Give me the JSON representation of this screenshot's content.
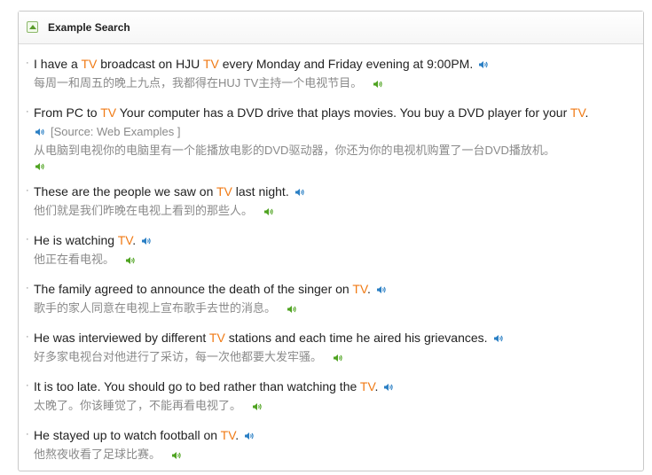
{
  "header": {
    "title": "Example Search",
    "toggle_icon": "collapse-chevron-up-icon"
  },
  "colors": {
    "highlight": "#f07a14",
    "english_text": "#222222",
    "chinese_text": "#8a8a8a",
    "speaker_en": "#2a7fc4",
    "speaker_zh": "#4fa321"
  },
  "examples": [
    {
      "en_parts": [
        "I have a ",
        "TV",
        " broadcast on HJU ",
        "TV",
        " every Monday and Friday evening at 9:00PM."
      ],
      "zh": "每周一和周五的晚上九点，我都得在HUJ TV主持一个电视节目。"
    },
    {
      "en_parts": [
        "From PC to ",
        "TV",
        " Your computer has a DVD drive that plays movies. You buy a DVD player for your ",
        "TV",
        "."
      ],
      "source": "[Source: Web Examples ]",
      "zh": "从电脑到电视你的电脑里有一个能播放电影的DVD驱动器，你还为你的电视机购置了一台DVD播放机。"
    },
    {
      "en_parts": [
        "These are the people we saw on ",
        "TV",
        " last night."
      ],
      "zh": "他们就是我们昨晚在电视上看到的那些人。"
    },
    {
      "en_parts": [
        "He is watching ",
        "TV",
        "."
      ],
      "zh": "他正在看电视。"
    },
    {
      "en_parts": [
        "The family agreed to announce the death of the singer on ",
        "TV",
        "."
      ],
      "zh": "歌手的家人同意在电视上宣布歌手去世的消息。"
    },
    {
      "en_parts": [
        "He was interviewed by different ",
        "TV",
        " stations and each time he aired his grievances."
      ],
      "zh": "好多家电视台对他进行了采访，每一次他都要大发牢骚。"
    },
    {
      "en_parts": [
        "It is too late. You should go to bed rather than watching the ",
        "TV",
        "."
      ],
      "zh": "太晚了。你该睡觉了，不能再看电视了。"
    },
    {
      "en_parts": [
        "He stayed up to watch football on ",
        "TV",
        "."
      ],
      "zh": "他熬夜收看了足球比赛。"
    }
  ]
}
